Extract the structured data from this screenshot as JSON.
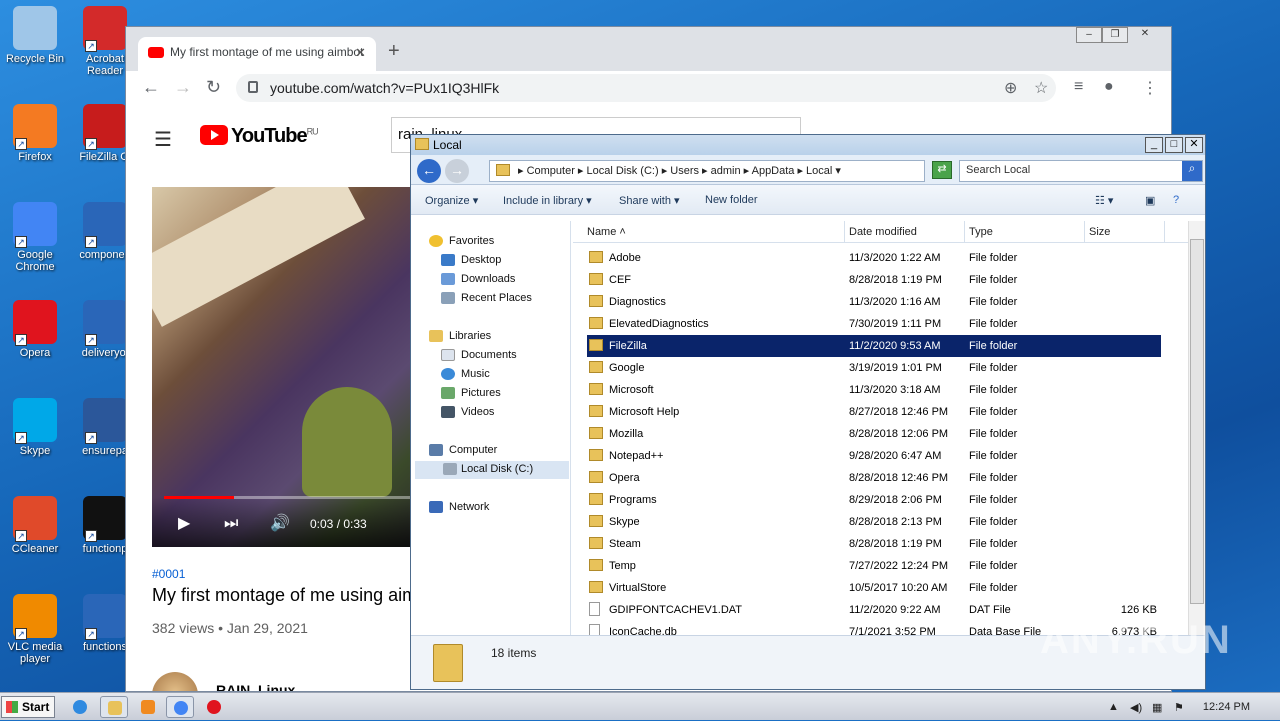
{
  "desktop": {
    "icons": [
      {
        "name": "recycle-bin",
        "label": "Recycle Bin",
        "color": "#9fc6e8"
      },
      {
        "name": "acrobat-reader",
        "label": "Acrobat Reader",
        "color": "#d32a2a"
      },
      {
        "name": "firefox",
        "label": "Firefox",
        "color": "#f47a22"
      },
      {
        "name": "filezilla-client",
        "label": "FileZilla Cl",
        "color": "#c71c1c"
      },
      {
        "name": "google-chrome",
        "label": "Google Chrome",
        "color": "#4285f4"
      },
      {
        "name": "component",
        "label": "componen",
        "color": "#2a66b8"
      },
      {
        "name": "opera",
        "label": "Opera",
        "color": "#e0141e"
      },
      {
        "name": "deliveryoi",
        "label": "deliveryoi",
        "color": "#2a66b8"
      },
      {
        "name": "skype",
        "label": "Skype",
        "color": "#00a8e8"
      },
      {
        "name": "ensurepa",
        "label": "ensurepa",
        "color": "#2b579a"
      },
      {
        "name": "ccleaner",
        "label": "CCleaner",
        "color": "#e04a2a"
      },
      {
        "name": "functionp",
        "label": "functionp",
        "color": "#111111"
      },
      {
        "name": "vlc",
        "label": "VLC media player",
        "color": "#f08a00"
      },
      {
        "name": "functions",
        "label": "functions",
        "color": "#2a66b8"
      }
    ]
  },
  "chrome": {
    "tab_title": "My first montage of me using aimbot",
    "url": "youtube.com/watch?v=PUx1IQ3HlFk",
    "youtube": {
      "logo_text": "YouTube",
      "region": "RU",
      "search_value": "rain_linux",
      "video_time": "0:03 / 0:33",
      "tag": "#0001",
      "title": "My first montage of me using aim",
      "meta": "382 views • Jan 29, 2021",
      "channel": "RAIN_Linux"
    }
  },
  "explorer": {
    "title": "Local",
    "breadcrumb": [
      "Computer",
      "Local Disk (C:)",
      "Users",
      "admin",
      "AppData",
      "Local"
    ],
    "search_placeholder": "Search Local",
    "toolbar": {
      "organize": "Organize",
      "include": "Include in library",
      "share": "Share with",
      "new_folder": "New folder"
    },
    "nav": {
      "favorites": "Favorites",
      "desktop": "Desktop",
      "downloads": "Downloads",
      "recent": "Recent Places",
      "libraries": "Libraries",
      "documents": "Documents",
      "music": "Music",
      "pictures": "Pictures",
      "videos": "Videos",
      "computer": "Computer",
      "local_disk": "Local Disk (C:)",
      "network": "Network"
    },
    "columns": {
      "name": "Name",
      "date": "Date modified",
      "type": "Type",
      "size": "Size"
    },
    "rows": [
      {
        "name": "Adobe",
        "date": "11/3/2020 1:22 AM",
        "type": "File folder",
        "size": ""
      },
      {
        "name": "CEF",
        "date": "8/28/2018 1:19 PM",
        "type": "File folder",
        "size": ""
      },
      {
        "name": "Diagnostics",
        "date": "11/3/2020 1:16 AM",
        "type": "File folder",
        "size": ""
      },
      {
        "name": "ElevatedDiagnostics",
        "date": "7/30/2019 1:11 PM",
        "type": "File folder",
        "size": ""
      },
      {
        "name": "FileZilla",
        "date": "11/2/2020 9:53 AM",
        "type": "File folder",
        "size": ""
      },
      {
        "name": "Google",
        "date": "3/19/2019 1:01 PM",
        "type": "File folder",
        "size": ""
      },
      {
        "name": "Microsoft",
        "date": "11/3/2020 3:18 AM",
        "type": "File folder",
        "size": ""
      },
      {
        "name": "Microsoft Help",
        "date": "8/27/2018 12:46 PM",
        "type": "File folder",
        "size": ""
      },
      {
        "name": "Mozilla",
        "date": "8/28/2018 12:06 PM",
        "type": "File folder",
        "size": ""
      },
      {
        "name": "Notepad++",
        "date": "9/28/2020 6:47 AM",
        "type": "File folder",
        "size": ""
      },
      {
        "name": "Opera",
        "date": "8/28/2018 12:46 PM",
        "type": "File folder",
        "size": ""
      },
      {
        "name": "Programs",
        "date": "8/29/2018 2:06 PM",
        "type": "File folder",
        "size": ""
      },
      {
        "name": "Skype",
        "date": "8/28/2018 2:13 PM",
        "type": "File folder",
        "size": ""
      },
      {
        "name": "Steam",
        "date": "8/28/2018 1:19 PM",
        "type": "File folder",
        "size": ""
      },
      {
        "name": "Temp",
        "date": "7/27/2022 12:24 PM",
        "type": "File folder",
        "size": ""
      },
      {
        "name": "VirtualStore",
        "date": "10/5/2017 10:20 AM",
        "type": "File folder",
        "size": ""
      },
      {
        "name": "GDIPFONTCACHEV1.DAT",
        "date": "11/2/2020 9:22 AM",
        "type": "DAT File",
        "size": "126 KB"
      },
      {
        "name": "IconCache.db",
        "date": "7/1/2021 3:52 PM",
        "type": "Data Base File",
        "size": "6,973 KB"
      }
    ],
    "selected_index": 4,
    "status_count": "18 items"
  },
  "watermark": "ANY.RUN",
  "taskbar": {
    "start_label": "Start",
    "clock": "12:24 PM"
  }
}
